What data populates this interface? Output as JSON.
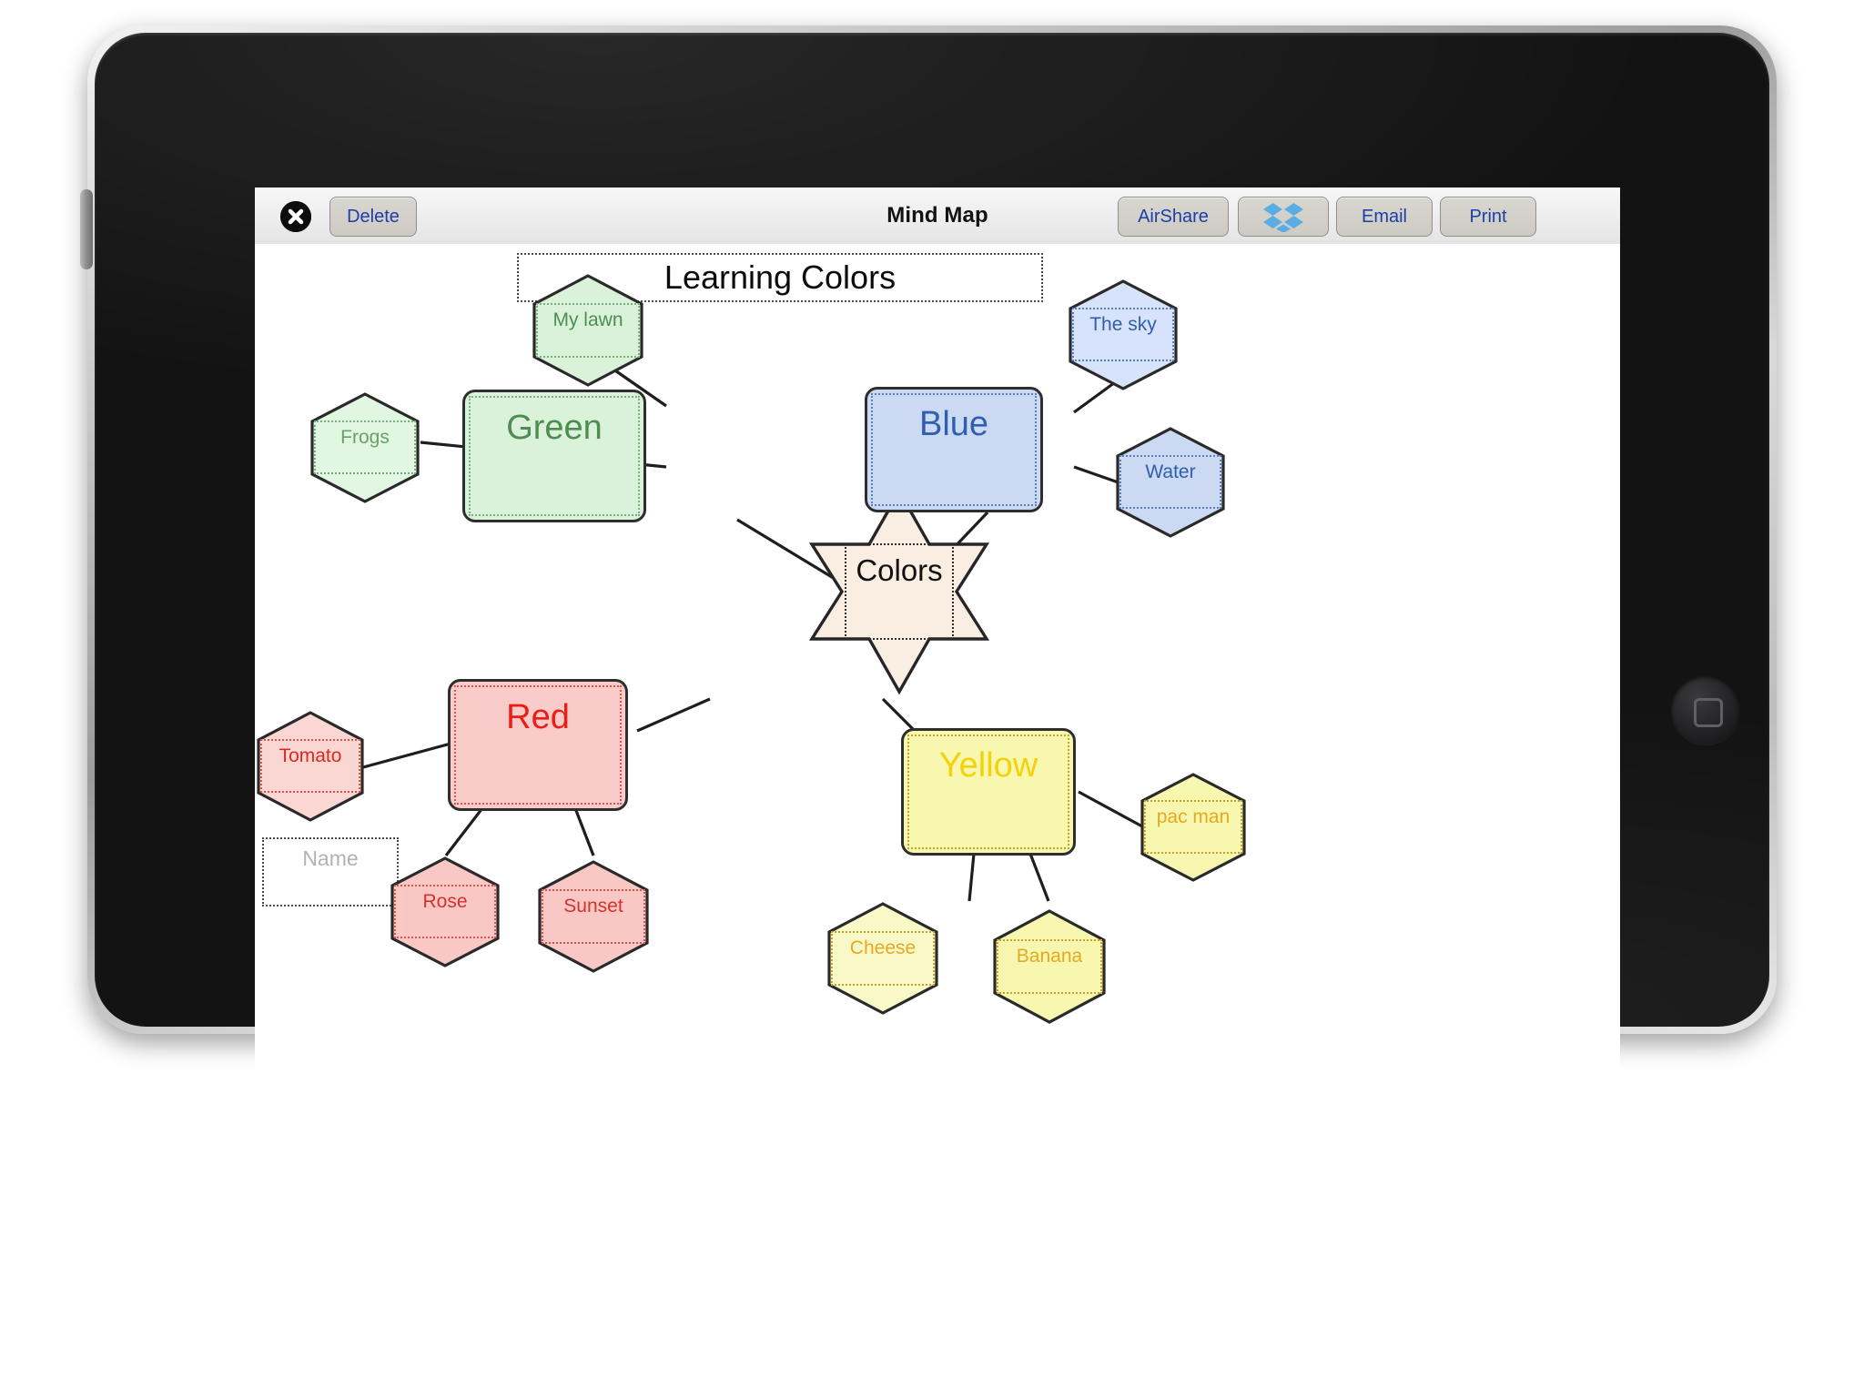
{
  "device": {
    "kind": "tablet",
    "home_button": "home-button"
  },
  "toolbar": {
    "title": "Mind Map",
    "close_icon": "close-x-icon",
    "delete_label": "Delete",
    "airshare_label": "AirShare",
    "dropbox_icon": "dropbox-icon",
    "email_label": "Email",
    "print_label": "Print"
  },
  "canvas": {
    "map_title": "Learning Colors",
    "name_field_placeholder": "Name",
    "name_field_value": ""
  },
  "mindmap": {
    "center": {
      "id": "colors",
      "label": "Colors",
      "shape": "star",
      "fill": "#faeee2",
      "stroke": "#262626",
      "text_color": "#111111"
    },
    "branches": [
      {
        "id": "green",
        "label": "Green",
        "shape": "rounded-rect",
        "fill": "#d9f2d9",
        "stroke": "#2e2e2e",
        "inner_stroke": "#6aa06a",
        "text_color": "#4e8c52",
        "children": [
          {
            "id": "my-lawn",
            "label": "My lawn",
            "shape": "hexagon",
            "fill": "#d9f2d9",
            "stroke": "#2a2a2a",
            "inner_stroke": "#6aa06a",
            "text_color": "#4e8c52"
          },
          {
            "id": "frogs",
            "label": "Frogs",
            "shape": "hexagon",
            "fill": "#e2f7e2",
            "stroke": "#2a2a2a",
            "inner_stroke": "#6aa06a",
            "text_color": "#6aa06a"
          }
        ]
      },
      {
        "id": "blue",
        "label": "Blue",
        "shape": "rounded-rect",
        "fill": "#ccd9f2",
        "stroke": "#2e2e2e",
        "inner_stroke": "#4a6fb5",
        "text_color": "#2f5fae",
        "children": [
          {
            "id": "the-sky",
            "label": "The sky",
            "shape": "hexagon",
            "fill": "#d6e3fb",
            "stroke": "#2a2a2a",
            "inner_stroke": "#4a6fb5",
            "text_color": "#2f5fae"
          },
          {
            "id": "water",
            "label": "Water",
            "shape": "hexagon",
            "fill": "#ccd9f2",
            "stroke": "#2a2a2a",
            "inner_stroke": "#4a6fb5",
            "text_color": "#2f5fae"
          }
        ]
      },
      {
        "id": "red",
        "label": "Red",
        "shape": "rounded-rect",
        "fill": "#f9ccc9",
        "stroke": "#2e2e2e",
        "inner_stroke": "#d6312c",
        "text_color": "#ee1b16",
        "children": [
          {
            "id": "tomato",
            "label": "Tomato",
            "shape": "hexagon",
            "fill": "#fbd7d4",
            "stroke": "#2a2a2a",
            "inner_stroke": "#d6312c",
            "text_color": "#e02720"
          },
          {
            "id": "rose",
            "label": "Rose",
            "shape": "hexagon",
            "fill": "#f9c8c4",
            "stroke": "#2a2a2a",
            "inner_stroke": "#d6312c",
            "text_color": "#d6312c"
          },
          {
            "id": "sunset",
            "label": "Sunset",
            "shape": "hexagon",
            "fill": "#f9c8c4",
            "stroke": "#2a2a2a",
            "inner_stroke": "#d6312c",
            "text_color": "#d6312c"
          }
        ]
      },
      {
        "id": "yellow",
        "label": "Yellow",
        "shape": "rounded-rect",
        "fill": "#f7f7b0",
        "stroke": "#2e2e2e",
        "inner_stroke": "#c8a227",
        "text_color": "#f5d10a",
        "children": [
          {
            "id": "pac-man",
            "label": "pac man",
            "shape": "hexagon",
            "fill": "#f7f7b0",
            "stroke": "#2a2a2a",
            "inner_stroke": "#c8a227",
            "text_color": "#e8a81f"
          },
          {
            "id": "cheese",
            "label": "Cheese",
            "shape": "hexagon",
            "fill": "#f9f9c8",
            "stroke": "#2a2a2a",
            "inner_stroke": "#c8a227",
            "text_color": "#e8a81f"
          },
          {
            "id": "banana",
            "label": "Banana",
            "shape": "hexagon",
            "fill": "#f7f7b0",
            "stroke": "#2a2a2a",
            "inner_stroke": "#c8a227",
            "text_color": "#e8a81f"
          }
        ]
      }
    ],
    "edges": [
      [
        "colors",
        "green"
      ],
      [
        "colors",
        "blue"
      ],
      [
        "colors",
        "red"
      ],
      [
        "colors",
        "yellow"
      ],
      [
        "green",
        "my-lawn"
      ],
      [
        "green",
        "frogs"
      ],
      [
        "blue",
        "the-sky"
      ],
      [
        "blue",
        "water"
      ],
      [
        "red",
        "tomato"
      ],
      [
        "red",
        "rose"
      ],
      [
        "red",
        "sunset"
      ],
      [
        "yellow",
        "pac-man"
      ],
      [
        "yellow",
        "cheese"
      ],
      [
        "yellow",
        "banana"
      ]
    ]
  }
}
